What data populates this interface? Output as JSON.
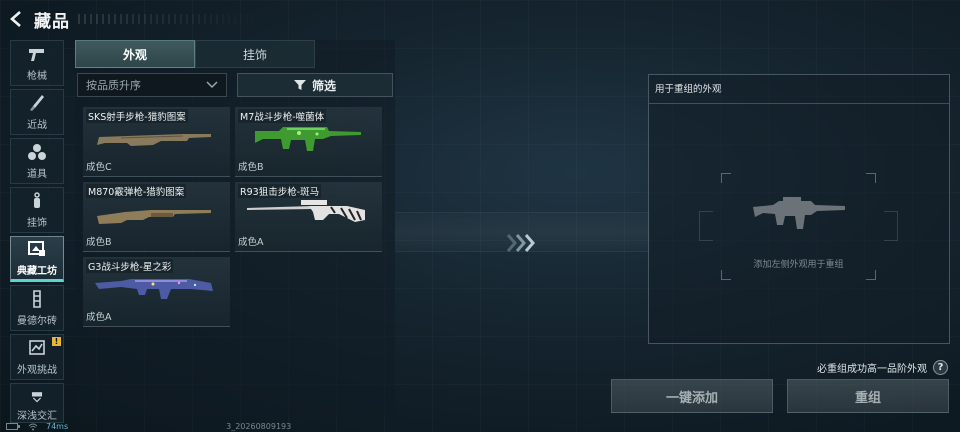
{
  "header": {
    "title": "藏品"
  },
  "sidebar": {
    "items": [
      {
        "label": "枪械",
        "icon": "pistol-icon",
        "active": false
      },
      {
        "label": "近战",
        "icon": "knife-icon",
        "active": false
      },
      {
        "label": "道具",
        "icon": "grenade-icon",
        "active": false
      },
      {
        "label": "挂饰",
        "icon": "charm-icon",
        "active": false
      },
      {
        "label": "典藏工坊",
        "icon": "workshop-icon",
        "active": true
      },
      {
        "label": "曼德尔砖",
        "icon": "brick-icon",
        "active": false
      },
      {
        "label": "外观挑战",
        "icon": "challenge-icon",
        "active": false,
        "badge": "!"
      },
      {
        "label": "深浅交汇",
        "icon": "fusion-icon",
        "active": false
      }
    ]
  },
  "tabs": [
    {
      "label": "外观",
      "active": true
    },
    {
      "label": "挂饰",
      "active": false
    }
  ],
  "sort": {
    "value": "按品质升序"
  },
  "filter": {
    "label": "筛选"
  },
  "skins": [
    {
      "name": "SKS射手步枪-猎豹图案",
      "grade": "成色C",
      "color": "#8a7a5c"
    },
    {
      "name": "M7战斗步枪-噬菌体",
      "grade": "成色B",
      "color": "#4fbf3a"
    },
    {
      "name": "M870霰弹枪-猎豹图案",
      "grade": "成色B",
      "color": "#8f7d5a"
    },
    {
      "name": "R93狙击步枪-斑马",
      "grade": "成色A",
      "color": "#d8d8d8"
    },
    {
      "name": "G3战斗步枪-星之彩",
      "grade": "成色A",
      "color": "#5a6bb0"
    }
  ],
  "preview": {
    "title": "用于重组的外观",
    "hint": "添加左侧外观用于重组"
  },
  "notice": {
    "text": "必重组成功高一品阶外观",
    "help": "?"
  },
  "buttons": {
    "add_label": "一键添加",
    "recombine_label": "重组"
  },
  "status": {
    "ping": "74ms",
    "build": "3_20260809193"
  }
}
